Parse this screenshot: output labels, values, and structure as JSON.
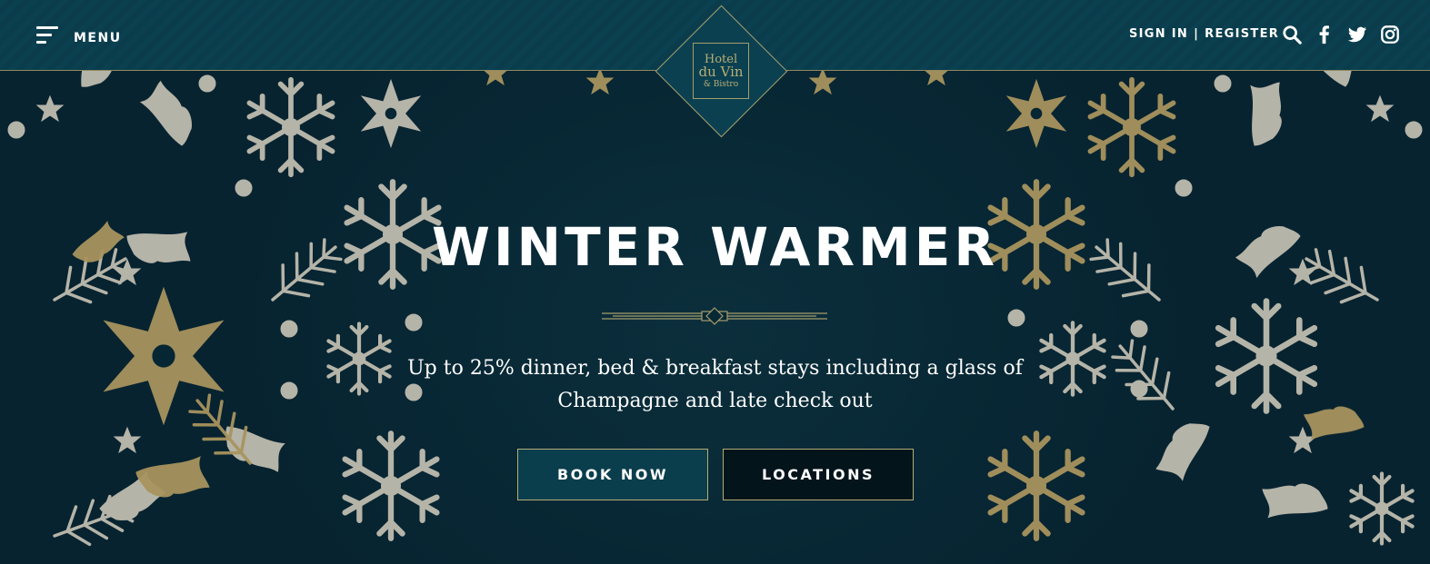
{
  "header": {
    "menu_label": "MENU",
    "sign_in": "SIGN IN",
    "separator": "|",
    "register": "REGISTER",
    "icons": [
      "search-icon",
      "facebook-icon",
      "twitter-icon",
      "instagram-icon"
    ]
  },
  "logo": {
    "line1": "Hotel",
    "line2": "du Vin",
    "line3": "& Bistro"
  },
  "hero": {
    "title": "WINTER WARMER",
    "subtitle_line1": "Up to 25% dinner, bed & breakfast stays including a glass of",
    "subtitle_line2": "Champagne and late check out",
    "book_label": "BOOK NOW",
    "locations_label": "LOCATIONS"
  },
  "colors": {
    "background": "#082835",
    "header": "#0b4050",
    "gold": "#a49d6c",
    "silver": "#c9c4b8",
    "book_button": "#0b3e4d",
    "locations_button": "#04141b"
  }
}
